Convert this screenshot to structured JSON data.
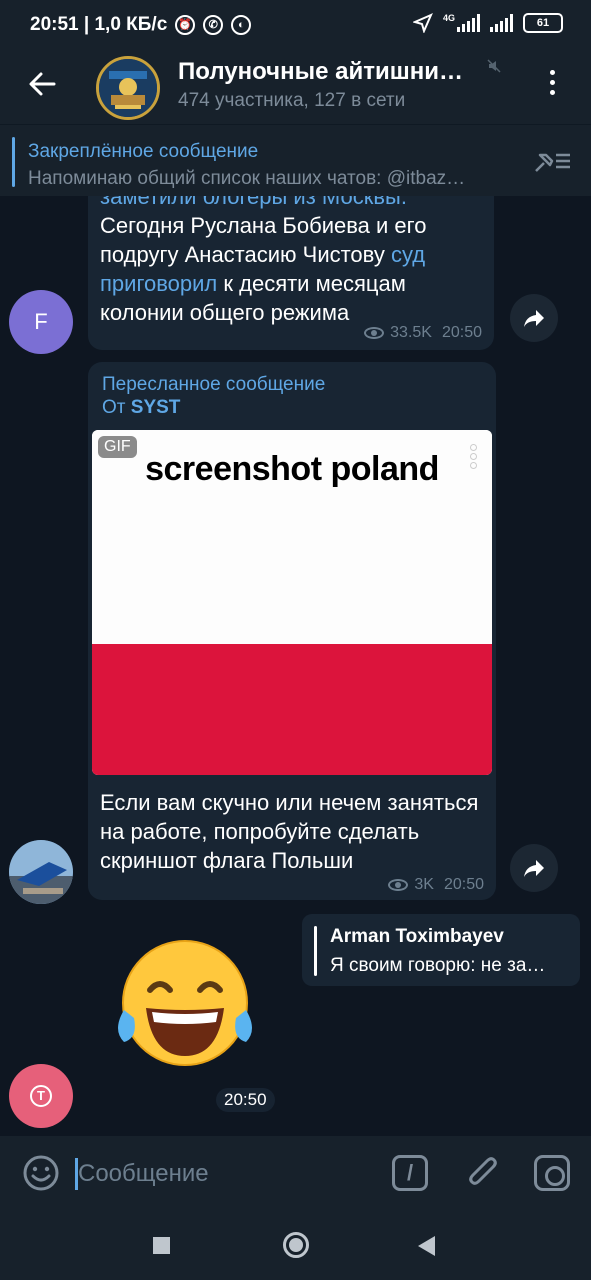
{
  "status_bar": {
    "time_speed": "20:51 | 1,0 КБ/с",
    "network": "4G",
    "battery": "61"
  },
  "header": {
    "title": "Полуночные айтишни…",
    "subtitle": "474 участника, 127 в сети"
  },
  "pinned": {
    "title": "Закреплённое сообщение",
    "text": "Напоминаю общий список наших чатов: @itbaz…"
  },
  "messages": {
    "m1": {
      "line_top": "заметили блогеры из Москвы.",
      "text_a": "Сегодня Руслана Бобиева и его подругу Анастасию Чистову ",
      "link": "суд приговорил",
      "text_b": " к десяти месяцам колонии общего режима",
      "views": "33.5K",
      "time": "20:50",
      "avatar_letter": "F",
      "avatar_color": "#7b6fd4"
    },
    "m2": {
      "forward_label": "Пересланное сообщение",
      "forward_from_prefix": "От ",
      "forward_from": "SYST",
      "gif_badge": "GIF",
      "gif_caption": "screenshot poland",
      "text": "Если вам скучно или нечем заняться на работе, попробуйте сделать скриншот флага Польши",
      "views": "3K",
      "time": "20:50"
    },
    "m3": {
      "reply_name": "Arman Toximbayev",
      "reply_text": "Я своим говорю: не за…",
      "emoji_name": "face-with-tears-of-joy",
      "time": "20:50",
      "avatar_letter": "T",
      "avatar_color": "#e6607a"
    }
  },
  "composer": {
    "placeholder": "Сообщение",
    "command_symbol": "/"
  },
  "colors": {
    "background": "#0e1621",
    "bar": "#17212b",
    "bubble": "#182533",
    "accent": "#5fa7e5",
    "flag_white": "#fdfdfd",
    "flag_red": "#dc143c"
  }
}
